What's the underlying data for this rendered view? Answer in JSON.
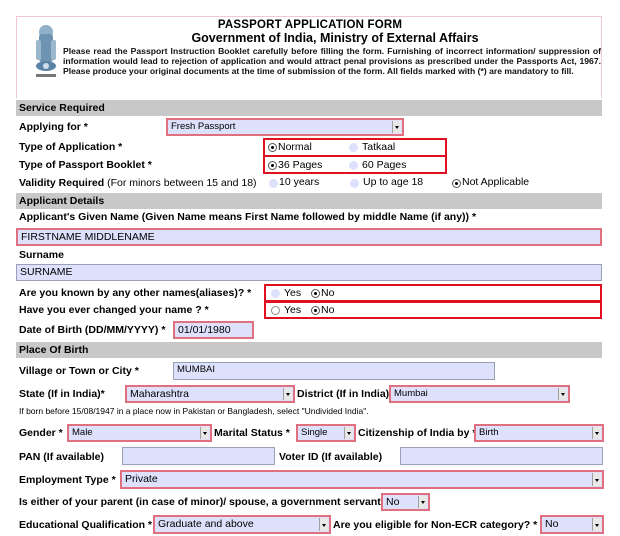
{
  "header": {
    "title": "PASSPORT APPLICATION FORM",
    "subtitle": "Government of India, Ministry of External Affairs",
    "instructions": "Please read the Passport Instruction Booklet carefully before filling the form. Furnishing of incorrect information/ suppression of information would lead to rejection of application and would attract penal provisions as prescribed under the Passports Act, 1967. Please produce your original documents at the time of submission of the form. All fields marked with (*) are mandatory to fill.",
    "emblem_icon": "india-state-emblem-icon"
  },
  "service": {
    "section_title": "Service Required",
    "applying_for_label": "Applying for *",
    "applying_for_value": "Fresh Passport",
    "application_type_label": "Type of Application *",
    "application_type_options": [
      {
        "label": "Normal",
        "selected": true
      },
      {
        "label": "Tatkaal",
        "selected": false
      }
    ],
    "booklet_label": "Type of Passport Booklet *",
    "booklet_options": [
      {
        "label": "36 Pages",
        "selected": true
      },
      {
        "label": "60 Pages",
        "selected": false
      }
    ],
    "validity_label": "Validity Required",
    "validity_note": "(For minors between 15 and 18)",
    "validity_options": [
      {
        "label": "10 years",
        "selected": false
      },
      {
        "label": "Up to age 18",
        "selected": false
      },
      {
        "label": "Not Applicable",
        "selected": true
      }
    ]
  },
  "applicant": {
    "section_title": "Applicant Details",
    "given_name_label": "Applicant's Given Name (Given Name means First Name followed by middle Name (if any)) *",
    "given_name_value": "FIRSTNAME MIDDLENAME",
    "surname_label": "Surname",
    "surname_value": "SURNAME",
    "aliases_label": "Are you known by any other names(aliases)? *",
    "aliases_options": [
      {
        "label": "Yes",
        "selected": false
      },
      {
        "label": "No",
        "selected": true
      }
    ],
    "changed_name_label": "Have you ever changed your name ? *",
    "changed_name_options": [
      {
        "label": "Yes",
        "selected": false
      },
      {
        "label": "No",
        "selected": true
      }
    ],
    "dob_label": "Date of Birth (DD/MM/YYYY) *",
    "dob_value": "01/01/1980"
  },
  "birthplace": {
    "section_title": "Place Of Birth",
    "city_label": "Village or Town or City *",
    "city_value": "MUMBAI",
    "state_label": "State (If in India)*",
    "state_value": "Maharashtra",
    "district_label": "District (If in India)*",
    "district_value": "Mumbai",
    "note": "If born before 15/08/1947 in a place now in Pakistan or Bangladesh, select \"Undivided India\"."
  },
  "personal": {
    "gender_label": "Gender *",
    "gender_value": "Male",
    "marital_label": "Marital Status *",
    "marital_value": "Single",
    "citizenship_label": "Citizenship of India by *",
    "citizenship_value": "Birth",
    "pan_label": "PAN (If available)",
    "pan_value": "",
    "voter_label": "Voter ID (If available)",
    "voter_value": "",
    "employment_label": "Employment Type *",
    "employment_value": "Private",
    "govt_servant_label": "Is either of your parent (in case of minor)/ spouse, a government servant? *",
    "govt_servant_value": "No",
    "education_label": "Educational Qualification *",
    "education_value": "Graduate and above",
    "non_ecr_label": "Are you eligible for Non-ECR category? *",
    "non_ecr_value": "No"
  }
}
